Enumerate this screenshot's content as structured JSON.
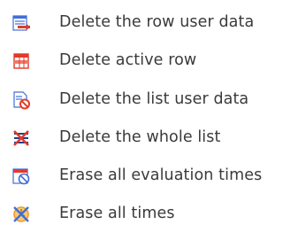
{
  "menu": {
    "items": [
      {
        "label": "Delete the row user data",
        "icon": "delete-row-user-data-icon"
      },
      {
        "label": "Delete active row",
        "icon": "delete-active-row-icon"
      },
      {
        "label": "Delete the list user data",
        "icon": "delete-list-user-data-icon"
      },
      {
        "label": "Delete the whole list",
        "icon": "delete-whole-list-icon"
      },
      {
        "label": "Erase all evaluation times",
        "icon": "erase-evaluation-times-icon"
      },
      {
        "label": "Erase all times",
        "icon": "erase-all-times-icon"
      }
    ]
  },
  "colors": {
    "text": "#3a3a3a",
    "icon_blue": "#3f6fd8",
    "icon_red": "#e23a2a",
    "icon_orange": "#f29a28"
  }
}
